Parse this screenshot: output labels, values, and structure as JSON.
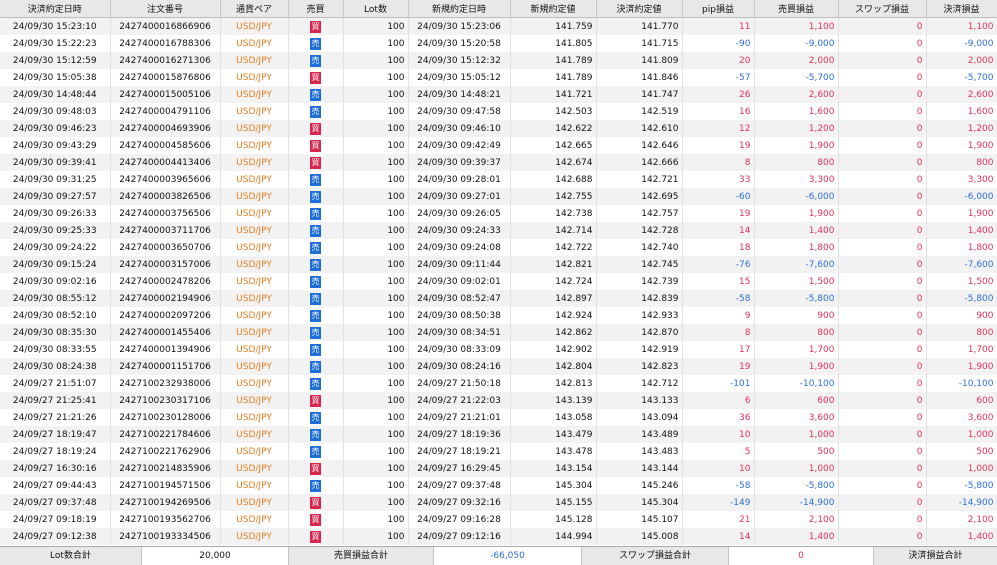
{
  "headers": [
    "決済約定日時",
    "注文番号",
    "通貨ペア",
    "売買",
    "Lot数",
    "新規約定日時",
    "新規約定値",
    "決済約定値",
    "pip損益",
    "売買損益",
    "スワップ損益",
    "決済損益"
  ],
  "side_labels": {
    "sell": "売",
    "buy": "買"
  },
  "colors": {
    "pair": "#e67e22",
    "sell": "#1e6fd9",
    "buy": "#d9264e",
    "negative": "#2f6fd6",
    "positive": "#e0335a"
  },
  "rows": [
    [
      "24/09/30 15:23:10",
      "2427400016866906",
      "USD/JPY",
      "buy",
      "100",
      "24/09/30 15:23:06",
      "141.759",
      "141.770",
      "11",
      "1,100",
      "0",
      "1,100"
    ],
    [
      "24/09/30 15:22:23",
      "2427400016788306",
      "USD/JPY",
      "sell",
      "100",
      "24/09/30 15:20:58",
      "141.805",
      "141.715",
      "-90",
      "-9,000",
      "0",
      "-9,000"
    ],
    [
      "24/09/30 15:12:59",
      "2427400016271306",
      "USD/JPY",
      "sell",
      "100",
      "24/09/30 15:12:32",
      "141.789",
      "141.809",
      "20",
      "2,000",
      "0",
      "2,000"
    ],
    [
      "24/09/30 15:05:38",
      "2427400015876806",
      "USD/JPY",
      "buy",
      "100",
      "24/09/30 15:05:12",
      "141.789",
      "141.846",
      "-57",
      "-5,700",
      "0",
      "-5,700"
    ],
    [
      "24/09/30 14:48:44",
      "2427400015005106",
      "USD/JPY",
      "sell",
      "100",
      "24/09/30 14:48:21",
      "141.721",
      "141.747",
      "26",
      "2,600",
      "0",
      "2,600"
    ],
    [
      "24/09/30 09:48:03",
      "2427400004791106",
      "USD/JPY",
      "sell",
      "100",
      "24/09/30 09:47:58",
      "142.503",
      "142.519",
      "16",
      "1,600",
      "0",
      "1,600"
    ],
    [
      "24/09/30 09:46:23",
      "2427400004693906",
      "USD/JPY",
      "buy",
      "100",
      "24/09/30 09:46:10",
      "142.622",
      "142.610",
      "12",
      "1,200",
      "0",
      "1,200"
    ],
    [
      "24/09/30 09:43:29",
      "2427400004585606",
      "USD/JPY",
      "buy",
      "100",
      "24/09/30 09:42:49",
      "142.665",
      "142.646",
      "19",
      "1,900",
      "0",
      "1,900"
    ],
    [
      "24/09/30 09:39:41",
      "2427400004413406",
      "USD/JPY",
      "buy",
      "100",
      "24/09/30 09:39:37",
      "142.674",
      "142.666",
      "8",
      "800",
      "0",
      "800"
    ],
    [
      "24/09/30 09:31:25",
      "2427400003965606",
      "USD/JPY",
      "sell",
      "100",
      "24/09/30 09:28:01",
      "142.688",
      "142.721",
      "33",
      "3,300",
      "0",
      "3,300"
    ],
    [
      "24/09/30 09:27:57",
      "2427400003826506",
      "USD/JPY",
      "sell",
      "100",
      "24/09/30 09:27:01",
      "142.755",
      "142.695",
      "-60",
      "-6,000",
      "0",
      "-6,000"
    ],
    [
      "24/09/30 09:26:33",
      "2427400003756506",
      "USD/JPY",
      "sell",
      "100",
      "24/09/30 09:26:05",
      "142.738",
      "142.757",
      "19",
      "1,900",
      "0",
      "1,900"
    ],
    [
      "24/09/30 09:25:33",
      "2427400003711706",
      "USD/JPY",
      "sell",
      "100",
      "24/09/30 09:24:33",
      "142.714",
      "142.728",
      "14",
      "1,400",
      "0",
      "1,400"
    ],
    [
      "24/09/30 09:24:22",
      "2427400003650706",
      "USD/JPY",
      "sell",
      "100",
      "24/09/30 09:24:08",
      "142.722",
      "142.740",
      "18",
      "1,800",
      "0",
      "1,800"
    ],
    [
      "24/09/30 09:15:24",
      "2427400003157006",
      "USD/JPY",
      "sell",
      "100",
      "24/09/30 09:11:44",
      "142.821",
      "142.745",
      "-76",
      "-7,600",
      "0",
      "-7,600"
    ],
    [
      "24/09/30 09:02:16",
      "2427400002478206",
      "USD/JPY",
      "sell",
      "100",
      "24/09/30 09:02:01",
      "142.724",
      "142.739",
      "15",
      "1,500",
      "0",
      "1,500"
    ],
    [
      "24/09/30 08:55:12",
      "2427400002194906",
      "USD/JPY",
      "sell",
      "100",
      "24/09/30 08:52:47",
      "142.897",
      "142.839",
      "-58",
      "-5,800",
      "0",
      "-5,800"
    ],
    [
      "24/09/30 08:52:10",
      "2427400002097206",
      "USD/JPY",
      "sell",
      "100",
      "24/09/30 08:50:38",
      "142.924",
      "142.933",
      "9",
      "900",
      "0",
      "900"
    ],
    [
      "24/09/30 08:35:30",
      "2427400001455406",
      "USD/JPY",
      "sell",
      "100",
      "24/09/30 08:34:51",
      "142.862",
      "142.870",
      "8",
      "800",
      "0",
      "800"
    ],
    [
      "24/09/30 08:33:55",
      "2427400001394906",
      "USD/JPY",
      "sell",
      "100",
      "24/09/30 08:33:09",
      "142.902",
      "142.919",
      "17",
      "1,700",
      "0",
      "1,700"
    ],
    [
      "24/09/30 08:24:38",
      "2427400001151706",
      "USD/JPY",
      "sell",
      "100",
      "24/09/30 08:24:16",
      "142.804",
      "142.823",
      "19",
      "1,900",
      "0",
      "1,900"
    ],
    [
      "24/09/27 21:51:07",
      "2427100232938006",
      "USD/JPY",
      "sell",
      "100",
      "24/09/27 21:50:18",
      "142.813",
      "142.712",
      "-101",
      "-10,100",
      "0",
      "-10,100"
    ],
    [
      "24/09/27 21:25:41",
      "2427100230317106",
      "USD/JPY",
      "buy",
      "100",
      "24/09/27 21:22:03",
      "143.139",
      "143.133",
      "6",
      "600",
      "0",
      "600"
    ],
    [
      "24/09/27 21:21:26",
      "2427100230128006",
      "USD/JPY",
      "sell",
      "100",
      "24/09/27 21:21:01",
      "143.058",
      "143.094",
      "36",
      "3,600",
      "0",
      "3,600"
    ],
    [
      "24/09/27 18:19:47",
      "2427100221784606",
      "USD/JPY",
      "sell",
      "100",
      "24/09/27 18:19:36",
      "143.479",
      "143.489",
      "10",
      "1,000",
      "0",
      "1,000"
    ],
    [
      "24/09/27 18:19:24",
      "2427100221762906",
      "USD/JPY",
      "sell",
      "100",
      "24/09/27 18:19:21",
      "143.478",
      "143.483",
      "5",
      "500",
      "0",
      "500"
    ],
    [
      "24/09/27 16:30:16",
      "2427100214835906",
      "USD/JPY",
      "buy",
      "100",
      "24/09/27 16:29:45",
      "143.154",
      "143.144",
      "10",
      "1,000",
      "0",
      "1,000"
    ],
    [
      "24/09/27 09:44:43",
      "2427100194571506",
      "USD/JPY",
      "sell",
      "100",
      "24/09/27 09:37:48",
      "145.304",
      "145.246",
      "-58",
      "-5,800",
      "0",
      "-5,800"
    ],
    [
      "24/09/27 09:37:48",
      "2427100194269506",
      "USD/JPY",
      "buy",
      "100",
      "24/09/27 09:32:16",
      "145.155",
      "145.304",
      "-149",
      "-14,900",
      "0",
      "-14,900"
    ],
    [
      "24/09/27 09:18:19",
      "2427100193562706",
      "USD/JPY",
      "buy",
      "100",
      "24/09/27 09:16:28",
      "145.128",
      "145.107",
      "21",
      "2,100",
      "0",
      "2,100"
    ],
    [
      "24/09/27 09:12:38",
      "2427100193334506",
      "USD/JPY",
      "buy",
      "100",
      "24/09/27 09:12:16",
      "144.994",
      "145.008",
      "14",
      "1,400",
      "0",
      "1,400"
    ]
  ],
  "summary": {
    "lot_label": "Lot数合計",
    "lot_value": "20,000",
    "trade_label": "売買損益合計",
    "trade_value": "-66,050",
    "swap_label": "スワップ損益合計",
    "swap_value": "0",
    "settle_label": "決済損益合計"
  }
}
